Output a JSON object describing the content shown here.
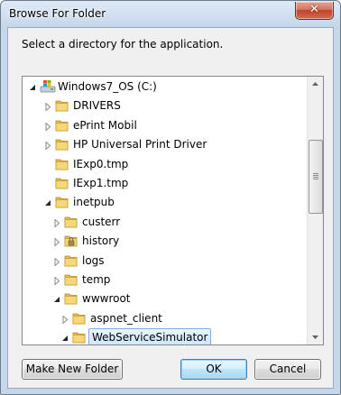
{
  "window": {
    "title": "Browse For Folder",
    "close_glyph": "✕"
  },
  "prompt": "Select a directory for the application.",
  "tree": {
    "items": [
      {
        "label": "Windows7_OS (C:)",
        "icon": "drive-icon",
        "expanded": true,
        "level": 0
      },
      {
        "label": "DRIVERS",
        "icon": "folder-icon",
        "expanded": false,
        "level": 1
      },
      {
        "label": "ePrint Mobil",
        "icon": "folder-icon",
        "expanded": false,
        "level": 1
      },
      {
        "label": "HP Universal Print Driver",
        "icon": "folder-icon",
        "expanded": false,
        "level": 1
      },
      {
        "label": "IExp0.tmp",
        "icon": "folder-icon",
        "level": 1
      },
      {
        "label": "IExp1.tmp",
        "icon": "folder-icon",
        "level": 1
      },
      {
        "label": "inetpub",
        "icon": "folder-icon",
        "expanded": true,
        "level": 1
      },
      {
        "label": "custerr",
        "icon": "folder-icon",
        "expanded": false,
        "level": 2
      },
      {
        "label": "history",
        "icon": "locked-folder-icon",
        "expanded": false,
        "level": 2
      },
      {
        "label": "logs",
        "icon": "folder-icon",
        "expanded": false,
        "level": 2
      },
      {
        "label": "temp",
        "icon": "folder-icon",
        "expanded": false,
        "level": 2
      },
      {
        "label": "wwwroot",
        "icon": "folder-icon",
        "expanded": true,
        "level": 2
      },
      {
        "label": "aspnet_client",
        "icon": "folder-icon",
        "expanded": false,
        "level": 3
      },
      {
        "label": "WebServiceSimulator",
        "icon": "folder-icon",
        "expanded": true,
        "level": 3,
        "selected": true
      }
    ]
  },
  "buttons": {
    "make_new_folder": "Make New Folder",
    "ok": "OK",
    "cancel": "Cancel"
  }
}
